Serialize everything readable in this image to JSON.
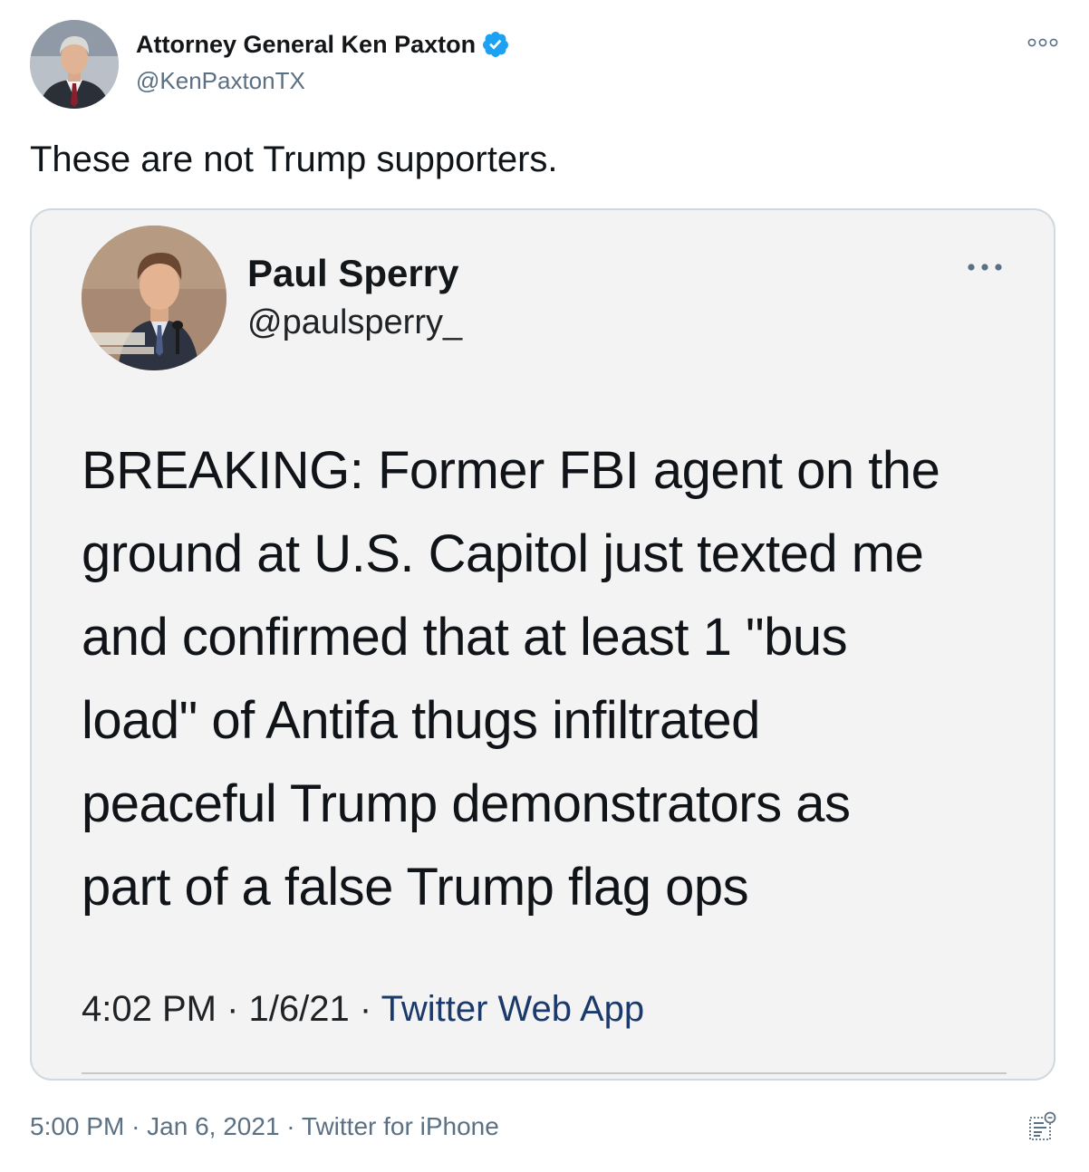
{
  "tweet": {
    "author": {
      "name": "Attorney General Ken Paxton",
      "handle": "@KenPaxtonTX",
      "verified": true,
      "avatar_icon": "profile-photo"
    },
    "more_icon": "more-options-icon",
    "text": "These are not Trump supporters.",
    "footer": {
      "time": "5:00 PM",
      "separator": "·",
      "date": "Jan 6, 2021",
      "source": "Twitter for iPhone",
      "analytics_icon": "analytics-icon"
    }
  },
  "quoted_image": {
    "author": {
      "name": "Paul Sperry",
      "handle": "@paulsperry_",
      "avatar_icon": "profile-photo"
    },
    "more_icon": "more-options-icon",
    "lines": [
      "BREAKING: Former FBI agent on the",
      "ground at U.S. Capitol just texted me",
      "and confirmed that at least 1 \"bus",
      "load\" of Antifa thugs infiltrated",
      "peaceful Trump demonstrators as",
      "part of a false Trump flag ops"
    ],
    "meta": {
      "time": "4:02 PM",
      "separator": "·",
      "date": "1/6/21",
      "source": "Twitter Web App"
    }
  },
  "colors": {
    "verified_blue": "#1da1f2",
    "secondary_text": "#5b7083",
    "card_border": "#cfd9de",
    "card_background": "#f3f3f3",
    "link_dark_blue": "#1b3a6b"
  }
}
